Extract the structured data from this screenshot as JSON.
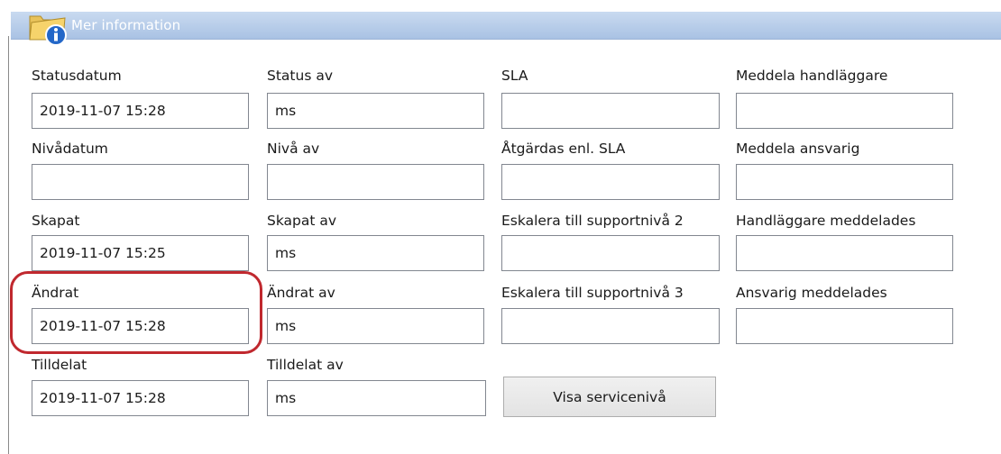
{
  "header": {
    "title": "Mer information",
    "icon": "folder-info-icon"
  },
  "fields": {
    "statusdatum": {
      "label": "Statusdatum",
      "value": "2019-11-07 15:28"
    },
    "status_av": {
      "label": "Status av",
      "value": "ms"
    },
    "sla": {
      "label": "SLA",
      "value": ""
    },
    "meddela_handlaggare": {
      "label": "Meddela handläggare",
      "value": ""
    },
    "nivadatum": {
      "label": "Nivådatum",
      "value": ""
    },
    "niva_av": {
      "label": "Nivå av",
      "value": ""
    },
    "atgardas_enl_sla": {
      "label": "Åtgärdas enl. SLA",
      "value": ""
    },
    "meddela_ansvarig": {
      "label": "Meddela ansvarig",
      "value": ""
    },
    "skapat": {
      "label": "Skapat",
      "value": "2019-11-07 15:25"
    },
    "skapat_av": {
      "label": "Skapat av",
      "value": "ms"
    },
    "eskalera_niva_2": {
      "label": "Eskalera till supportnivå 2",
      "value": ""
    },
    "handlaggare_meddelades": {
      "label": "Handläggare meddelades",
      "value": ""
    },
    "andrat": {
      "label": "Ändrat",
      "value": "2019-11-07 15:28"
    },
    "andrat_av": {
      "label": "Ändrat av",
      "value": "ms"
    },
    "eskalera_niva_3": {
      "label": "Eskalera till supportnivå 3",
      "value": ""
    },
    "ansvarig_meddelades": {
      "label": "Ansvarig meddelades",
      "value": ""
    },
    "tilldelat": {
      "label": "Tilldelat",
      "value": "2019-11-07 15:28"
    },
    "tilldelat_av": {
      "label": "Tilldelat av",
      "value": "ms"
    }
  },
  "buttons": {
    "visa_serviceniva": "Visa servicenivå"
  },
  "colors": {
    "header_bar": "#b8cde9",
    "highlight_ring": "#c0282e",
    "field_border": "#828790",
    "button_background": "#e8e8e8"
  }
}
